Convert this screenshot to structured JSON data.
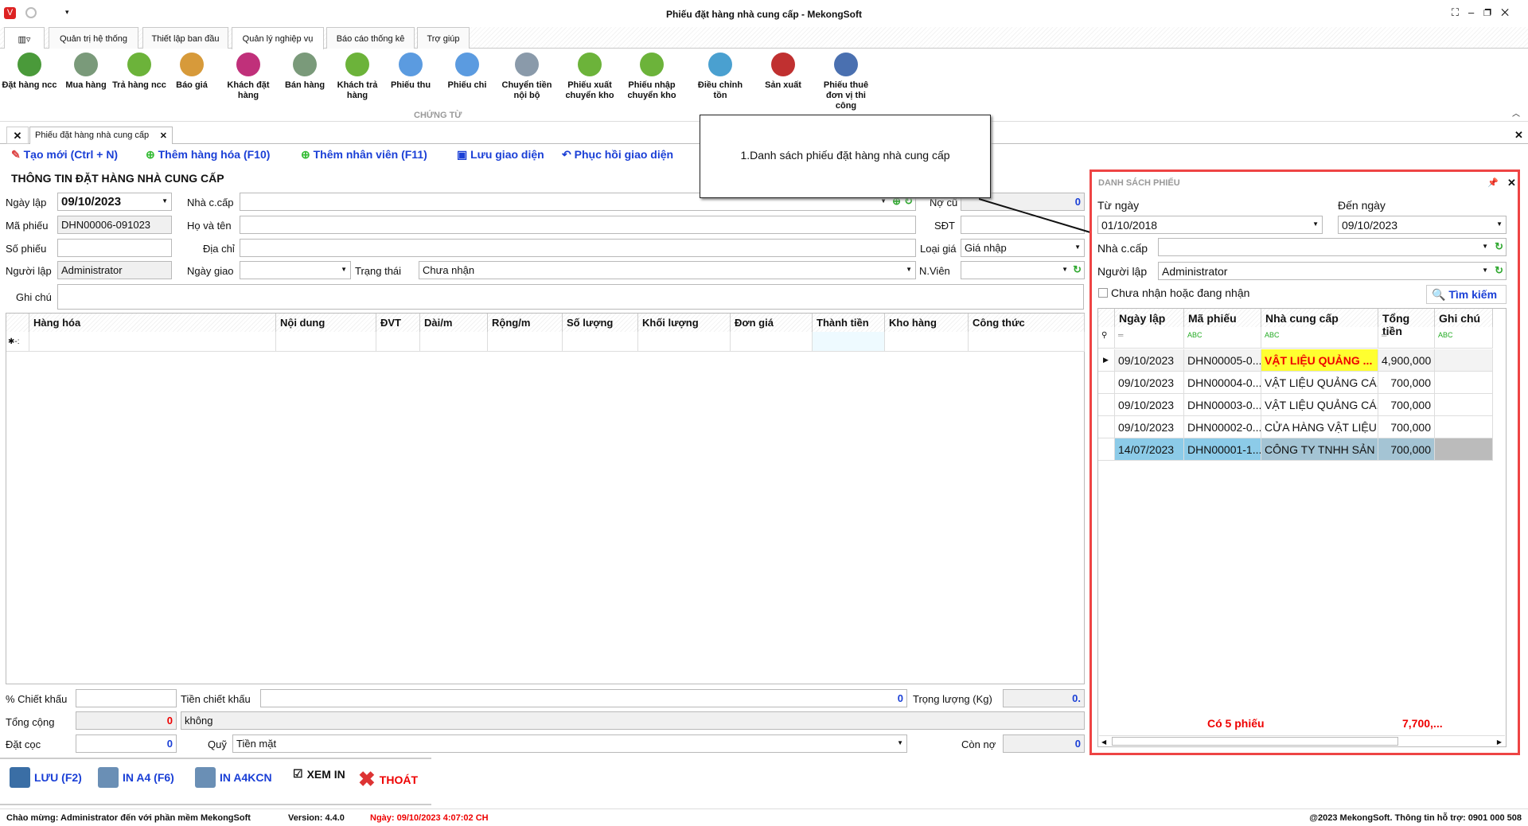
{
  "window": {
    "title": "Phiếu đặt hàng nhà cung cấp - MekongSoft"
  },
  "menu_tabs": [
    "Quản trị hệ thống",
    "Thiết lập ban đầu",
    "Quản lý nghiệp vụ",
    "Báo cáo thống kê",
    "Trợ giúp"
  ],
  "ribbon": {
    "group_label": "CHỨNG TỪ",
    "items": [
      {
        "label": "Đặt hàng ncc",
        "icon": "supplier-order-icon",
        "color": "#4a9a3a"
      },
      {
        "label": "Mua hàng",
        "icon": "cart-download-icon",
        "color": "#7a9a7a"
      },
      {
        "label": "Trả hàng ncc",
        "icon": "arrow-right-circle-icon",
        "color": "#6cb33a"
      },
      {
        "label": "Báo giá",
        "icon": "quote-document-icon",
        "color": "#d79a3a"
      },
      {
        "label": "Khách đặt hàng",
        "icon": "customer-order-icon",
        "color": "#c0307a"
      },
      {
        "label": "Bán hàng",
        "icon": "cart-upload-icon",
        "color": "#7a9a7a"
      },
      {
        "label": "Khách trả hàng",
        "icon": "arrow-left-circle-icon",
        "color": "#6cb33a"
      },
      {
        "label": "Phiếu thu",
        "icon": "plus-circle-icon",
        "color": "#5b9be0"
      },
      {
        "label": "Phiếu chi",
        "icon": "minus-circle-icon",
        "color": "#5b9be0"
      },
      {
        "label": "Chuyển tiền nội bộ",
        "icon": "coins-icon",
        "color": "#8a9aaa"
      },
      {
        "label": "Phiếu xuất chuyển kho",
        "icon": "arrow-up-circle-icon",
        "color": "#6cb33a"
      },
      {
        "label": "Phiếu nhập chuyển kho",
        "icon": "arrow-down-circle-icon",
        "color": "#6cb33a"
      },
      {
        "label": "Điều chỉnh tồn",
        "icon": "chart-adjust-icon",
        "color": "#4aa0d0"
      },
      {
        "label": "Sản xuất",
        "icon": "ab-transform-icon",
        "color": "#c03030"
      },
      {
        "label": "Phiếu thuê đơn vị thi công",
        "icon": "id-card-icon",
        "color": "#4a70b0"
      }
    ]
  },
  "doc_tab": "Phiếu đặt hàng nhà cung cấp",
  "toolbar": {
    "new": "Tạo mới (Ctrl + N)",
    "add_goods": "Thêm hàng hóa (F10)",
    "add_staff": "Thêm nhân viên (F11)",
    "save_layout": "Lưu giao diện",
    "restore_layout": "Phục hồi giao diện"
  },
  "tooltip": "1.Danh sách phiếu đặt hàng nhà cung cấp",
  "form": {
    "section_title": "THÔNG TIN ĐẶT HÀNG NHÀ CUNG CẤP",
    "ngay_lap_label": "Ngày lập",
    "ngay_lap": "09/10/2023",
    "ma_phieu_label": "Mã phiếu",
    "ma_phieu": "DHN00006-091023",
    "so_phieu_label": "Số phiếu",
    "nguoi_lap_label": "Người lập",
    "nguoi_lap": "Administrator",
    "ghi_chu_label": "Ghi chú",
    "ncc_label": "Nhà c.cấp",
    "ho_ten_label": "Họ và tên",
    "dia_chi_label": "Địa chỉ",
    "ngay_giao_label": "Ngày giao",
    "trang_thai_label": "Trạng thái",
    "trang_thai": "Chưa nhận",
    "no_cu_label": "Nợ cũ",
    "no_cu": "0",
    "sdt_label": "SĐT",
    "loai_gia_label": "Loại giá",
    "loai_gia": "Giá nhập",
    "nvien_label": "N.Viên"
  },
  "grid": {
    "columns": [
      "Hàng hóa",
      "Nội dung",
      "ĐVT",
      "Dài/m",
      "Rộng/m",
      "Số lượng",
      "Khối lượng",
      "Đơn giá",
      "Thành tiền",
      "Kho hàng",
      "Công thức"
    ],
    "new_row_marker": "✱-:"
  },
  "totals": {
    "chiet_khau_label": "% Chiết khấu",
    "tien_ck_label": "Tiền chiết khấu",
    "tien_ck": "0",
    "trong_luong_label": "Trọng lượng (Kg)",
    "trong_luong": "0.",
    "tong_cong_label": "Tổng cộng",
    "tong_cong": "0",
    "bang_chu": "không",
    "dat_coc_label": "Đặt cọc",
    "dat_coc": "0",
    "quy_label": "Quỹ",
    "quy": "Tiền mặt",
    "con_no_label": "Còn nợ",
    "con_no": "0"
  },
  "actions": {
    "save": "LƯU (F2)",
    "print_a4": "IN A4 (F6)",
    "print_a4kcn": "IN A4KCN",
    "preview": "XEM IN",
    "exit": "THOÁT"
  },
  "panel": {
    "title": "DANH SÁCH PHIẾU",
    "tu_ngay_label": "Từ ngày",
    "tu_ngay": "01/10/2018",
    "den_ngay_label": "Đến ngày",
    "den_ngay": "09/10/2023",
    "ncc_label": "Nhà c.cấp",
    "nguoi_lap_label": "Người lập",
    "nguoi_lap": "Administrator",
    "checkbox_label": "Chưa nhận hoặc đang nhận",
    "search": "Tìm kiếm",
    "columns": [
      "Ngày lập",
      "Mã phiếu",
      "Nhà cung cấp",
      "Tổng tiền",
      "Ghi chú"
    ],
    "rows": [
      [
        "09/10/2023",
        "DHN00005-0...",
        "VẬT LIỆU QUẢNG ...",
        "4,900,000",
        ""
      ],
      [
        "09/10/2023",
        "DHN00004-0...",
        "VẬT LIỆU QUẢNG CÁ...",
        "700,000",
        ""
      ],
      [
        "09/10/2023",
        "DHN00003-0...",
        "VẬT LIỆU QUẢNG CÁ...",
        "700,000",
        ""
      ],
      [
        "09/10/2023",
        "DHN00002-0...",
        "CỬA HÀNG VẬT LIỆU ...",
        "700,000",
        ""
      ],
      [
        "14/07/2023",
        "DHN00001-1...",
        "CÔNG TY TNHH SẢN ...",
        "700,000",
        ""
      ]
    ],
    "count": "Có 5 phiếu",
    "sum": "7,700,..."
  },
  "status": {
    "welcome": "Chào mừng: Administrator đến với phần mềm MekongSoft",
    "version": "Version: 4.4.0",
    "date": "Ngày: 09/10/2023 4:07:02 CH",
    "copyright": "@2023 MekongSoft. Thông tin hỗ trợ: 0901 000 508"
  }
}
